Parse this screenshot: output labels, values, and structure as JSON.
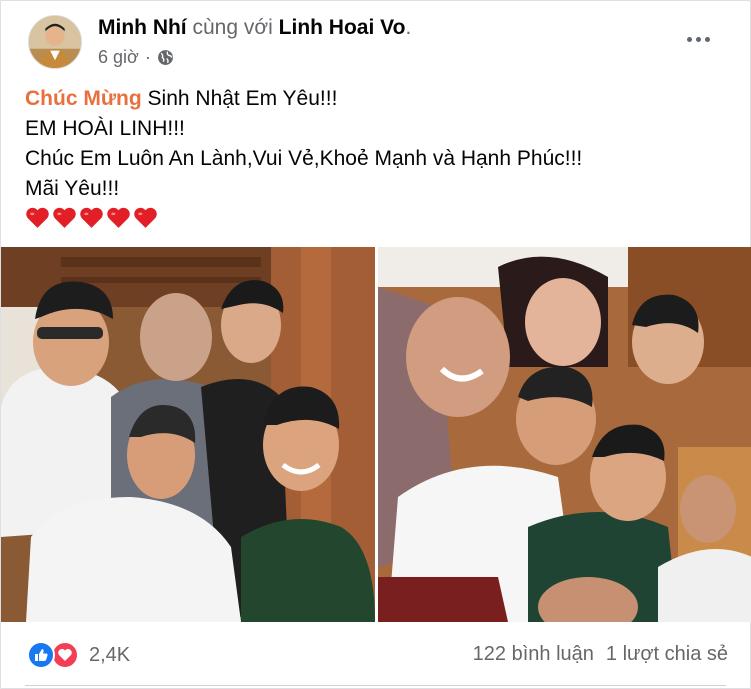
{
  "post": {
    "author": "Minh Nhí",
    "with_text": "cùng với",
    "tagged": "Linh Hoai Vo",
    "period": ".",
    "time": "6 giờ",
    "privacy_icon": "globe-icon",
    "more_icon": "more-options-icon"
  },
  "body": {
    "line1_highlight": "Chúc Mừng",
    "line1_rest": " Sinh Nhật Em Yêu!!!",
    "line2": "EM HOÀI LINH!!!",
    "line3": "Chúc Em Luôn An Lành,Vui Vẻ,Khoẻ Mạnh và Hạnh Phúc!!!",
    "line4": "Mãi Yêu!!!",
    "hearts_count": 5,
    "heart_icon": "red-heart-emoji"
  },
  "photos": [
    {
      "name": "group-selfie-left"
    },
    {
      "name": "group-selfie-right"
    }
  ],
  "footer": {
    "reaction_icons": [
      "like-icon",
      "love-icon"
    ],
    "reaction_count": "2,4K",
    "comments": "122 bình luận",
    "shares": "1 lượt chia sẻ"
  },
  "colors": {
    "highlight": "#e9703e",
    "secondary_text": "#65676b",
    "like_blue": "#1877f2",
    "love_red": "#f33e58"
  }
}
